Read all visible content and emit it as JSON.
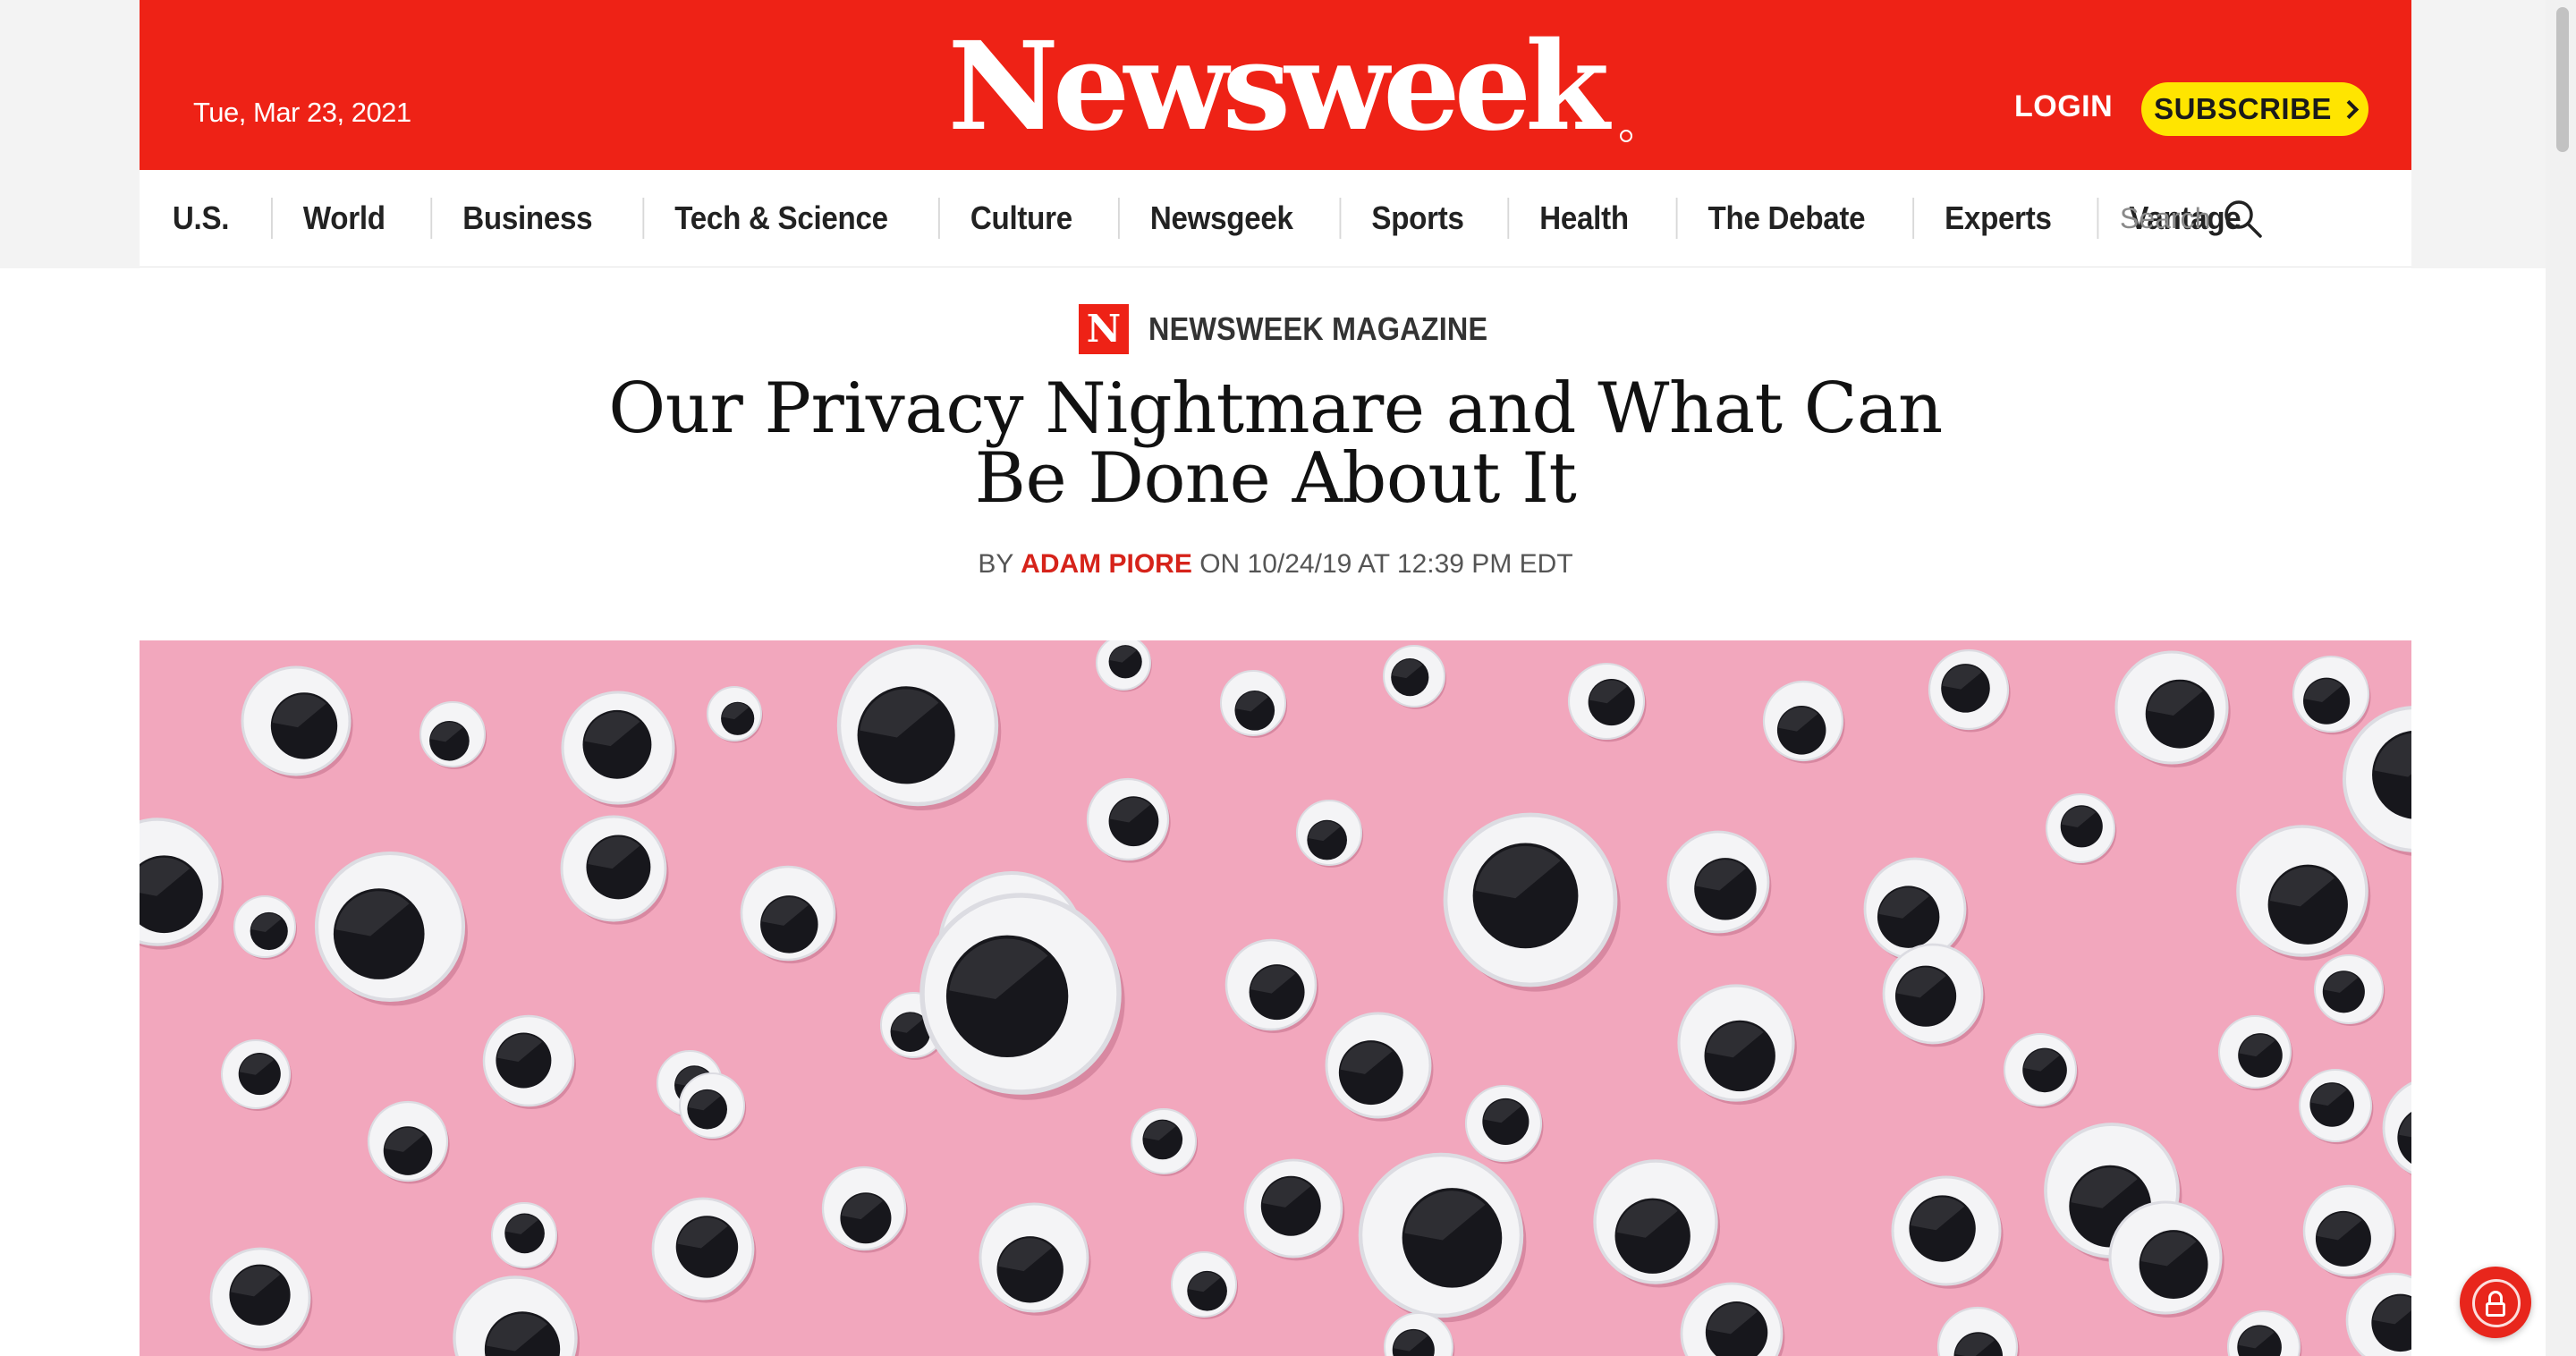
{
  "masthead": {
    "date": "Tue, Mar 23, 2021",
    "logo_text": "Newsweek",
    "login_label": "LOGIN",
    "subscribe_label": "SUBSCRIBE"
  },
  "nav": {
    "items": [
      {
        "label": "U.S."
      },
      {
        "label": "World"
      },
      {
        "label": "Business"
      },
      {
        "label": "Tech & Science"
      },
      {
        "label": "Culture"
      },
      {
        "label": "Newsgeek"
      },
      {
        "label": "Sports"
      },
      {
        "label": "Health"
      },
      {
        "label": "The Debate"
      },
      {
        "label": "Experts"
      },
      {
        "label": "Vantage"
      }
    ],
    "search_placeholder": "Search"
  },
  "article": {
    "section_badge": "N",
    "section": "NEWSWEEK MAGAZINE",
    "headline": "Our Privacy Nightmare and What Can Be Done About It",
    "byline_prefix": "BY",
    "author": "ADAM PIORE",
    "byline_suffix": "ON 10/24/19 AT 12:39 PM EDT",
    "hero_image": "googly-eyes-on-pink-background"
  },
  "colors": {
    "brand_red": "#ee2216",
    "subscribe_yellow": "#ffe500",
    "author_red": "#d6231a",
    "hero_pink": "#f2a7bd"
  },
  "icons": {
    "search": "search-icon",
    "privacy": "lock-icon"
  }
}
